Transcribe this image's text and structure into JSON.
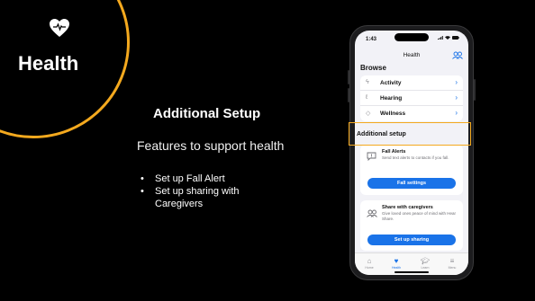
{
  "colors": {
    "accent": "#f4a91e",
    "blue": "#1a73e8",
    "background": "#000000"
  },
  "badge": {
    "title": "Health",
    "icon": "heart-pulse-icon"
  },
  "slide": {
    "title": "Additional Setup",
    "subtitle": "Features to support health",
    "bullets": [
      "Set up Fall Alert",
      "Set up sharing with Caregivers"
    ]
  },
  "phone": {
    "status_time": "1:43",
    "nav_title": "Health",
    "browse_header": "Browse",
    "browse_items": [
      {
        "label": "Activity",
        "icon": "activity-icon"
      },
      {
        "label": "Hearing",
        "icon": "ear-icon"
      },
      {
        "label": "Wellness",
        "icon": "wellness-icon"
      }
    ],
    "additional_header": "Additional setup",
    "fall_alerts": {
      "title": "Fall Alerts",
      "description": "Send text alerts to contacts if you fall.",
      "button": "Fall settings"
    },
    "caregivers": {
      "title": "Share with caregivers",
      "description": "Give loved ones peace of mind with Hear Share.",
      "button": "Set up sharing"
    },
    "tabs": [
      {
        "label": "Home",
        "icon": "home-icon"
      },
      {
        "label": "Health",
        "icon": "heart-icon",
        "active": true
      },
      {
        "label": "Learn",
        "icon": "graduation-cap-icon"
      },
      {
        "label": "Menu",
        "icon": "menu-icon"
      }
    ]
  }
}
